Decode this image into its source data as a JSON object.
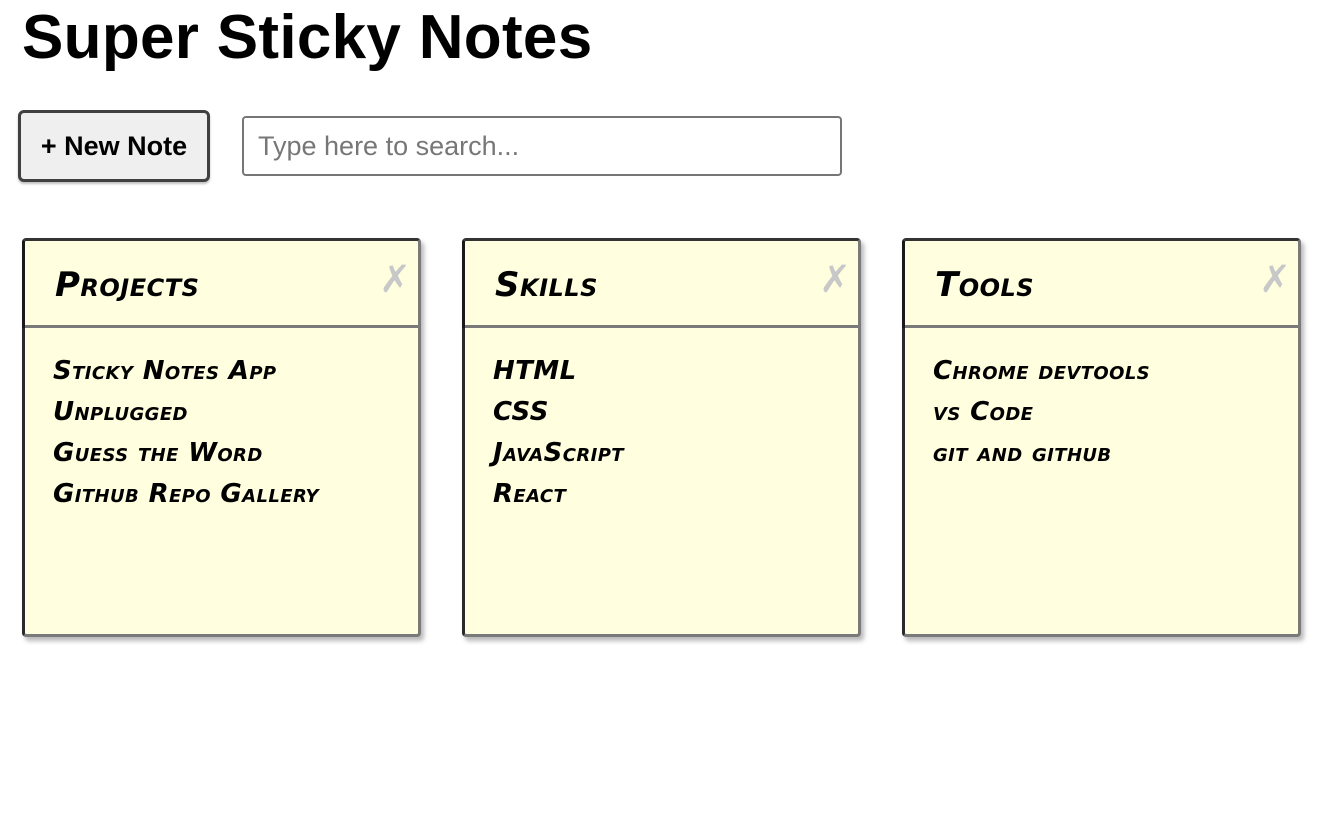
{
  "app": {
    "title": "Super Sticky Notes"
  },
  "toolbar": {
    "new_note_label": "+ New Note",
    "search_placeholder": "Type here to search...",
    "search_value": ""
  },
  "notes": [
    {
      "title": "Projects",
      "close_icon": "close-icon",
      "lines": [
        "Sticky Notes App",
        "Unplugged",
        "Guess the Word",
        "Github Repo Gallery"
      ]
    },
    {
      "title": "Skills",
      "close_icon": "close-icon",
      "lines": [
        "HTML",
        "CSS",
        "JavaScript",
        "React"
      ]
    },
    {
      "title": "Tools",
      "close_icon": "close-icon",
      "lines": [
        "Chrome devtools",
        "vs Code",
        "git and github"
      ]
    }
  ],
  "colors": {
    "note_background": "#ffffe0",
    "note_border": "#7a7a7a",
    "close_icon": "#c8c8c8",
    "button_background": "#efefef"
  }
}
